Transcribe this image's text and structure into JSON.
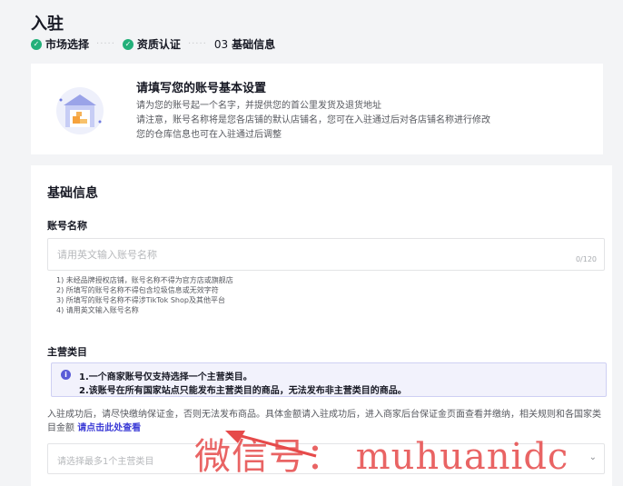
{
  "page": {
    "title": "入驻",
    "steps": [
      {
        "label": "市场选择",
        "status": "done"
      },
      {
        "label": "资质认证",
        "status": "done"
      },
      {
        "num": "03",
        "label": "基础信息",
        "status": "current"
      }
    ]
  },
  "intro": {
    "title": "请填写您的账号基本设置",
    "lines": [
      "请为您的账号起一个名字，并提供您的首公里发货及退货地址",
      "请注意，账号名称将是您各店铺的默认店铺名，您可在入驻通过后对各店铺名称进行修改",
      "您的仓库信息也可在入驻通过后调整"
    ]
  },
  "basic": {
    "section_title": "基础信息",
    "account_label": "账号名称",
    "account_placeholder": "请用英文输入账号名称",
    "account_counter": "0/120",
    "rules": [
      "1) 未经品牌授权店铺，账号名称不得为官方店或旗舰店",
      "2) 所填写的账号名称不得包含垃圾信息或无效字符",
      "3) 所填写的账号名称不得涉TikTok Shop及其他平台",
      "4) 请用英文输入账号名称"
    ],
    "category_label": "主营类目",
    "notice_lines": [
      "1.一个商家账号仅支持选择一个主营类目。",
      "2.该账号在所有国家站点只能发布主营类目的商品，无法发布非主营类目的商品。"
    ],
    "deposit_text": "入驻成功后，请尽快缴纳保证金，否则无法发布商品。具体金额请入驻成功后，进入商家后台保证金页面查看并缴纳，相关规则和各国家类目金额",
    "deposit_link": "请点击此处查看",
    "category_placeholder": "请选择最多1个主营类目"
  },
  "watermark": "微信号： muhuanidc",
  "colors": {
    "success": "#23b07a",
    "accent": "#3b3bd6",
    "notice_bg": "#f2f2fc",
    "watermark": "#e64a4a"
  }
}
